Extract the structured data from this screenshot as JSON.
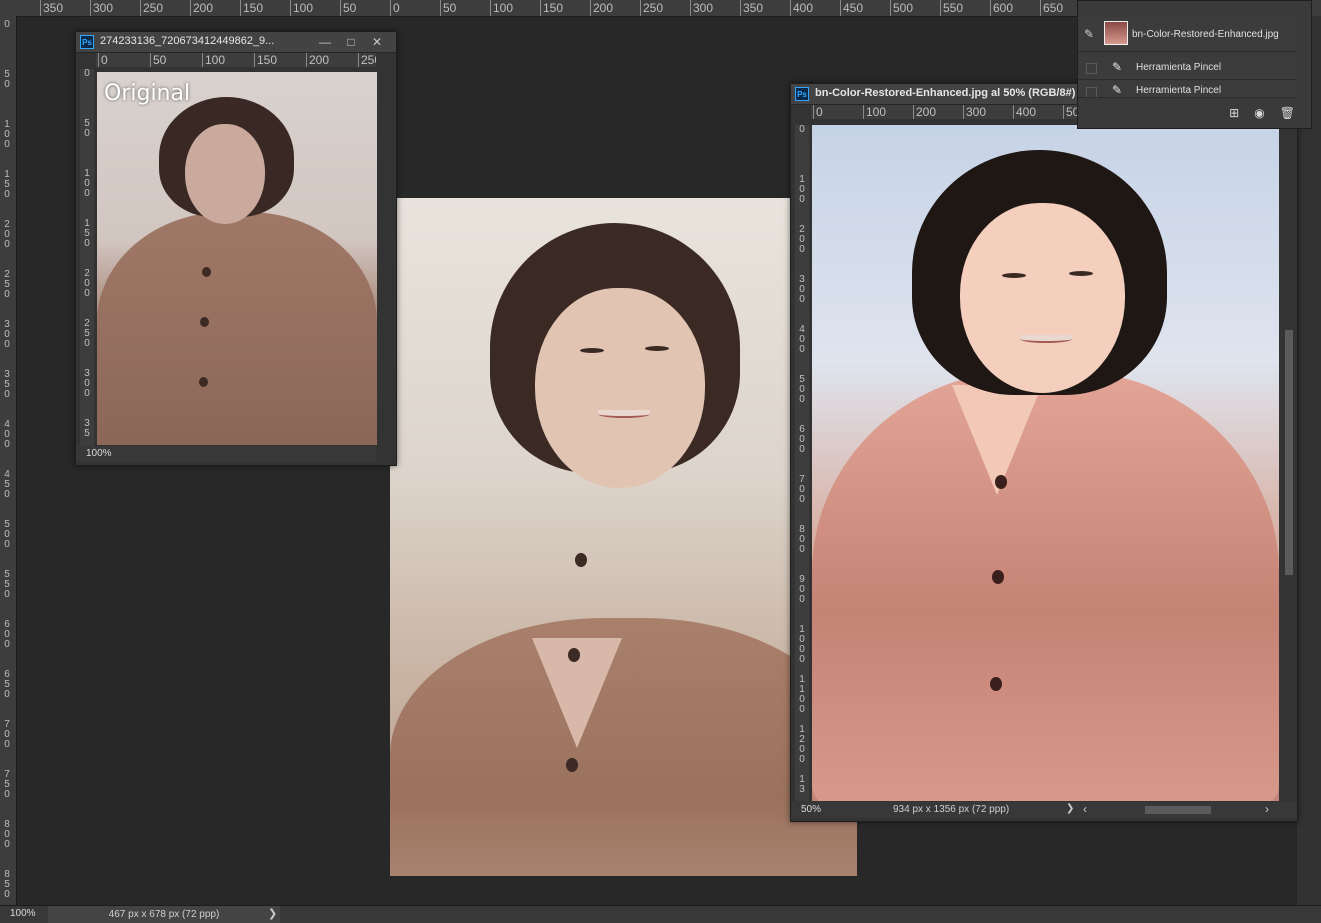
{
  "workspace": {
    "top_ruler_labels": [
      "350",
      "300",
      "250",
      "200",
      "150",
      "100",
      "50",
      "0",
      "50",
      "100",
      "150",
      "200",
      "250",
      "300",
      "350",
      "400",
      "450",
      "500",
      "550",
      "600",
      "650"
    ],
    "left_ruler_labels": [
      "0",
      "50",
      "100",
      "150",
      "200",
      "250",
      "300",
      "350",
      "400",
      "450",
      "500",
      "550",
      "600",
      "650",
      "700",
      "750",
      "800",
      "850"
    ],
    "status_zoom": "100%",
    "status_dims": "467 px x 678 px (72 ppp)",
    "status_arrow": "❯"
  },
  "original_window": {
    "title": "274233136_720673412449862_9...",
    "ps_badge": "Ps",
    "buttons": {
      "minimize": "—",
      "maximize": "□",
      "close": "✕"
    },
    "ruler_top_labels": [
      "0",
      "50",
      "100",
      "150",
      "200",
      "250"
    ],
    "ruler_left_labels": [
      "0",
      "50",
      "100",
      "150",
      "200",
      "250",
      "300",
      "35"
    ],
    "overlay_label": "Original",
    "status_zoom": "100%"
  },
  "enhanced_window": {
    "title": "bn-Color-Restored-Enhanced.jpg al 50% (RGB/8#)",
    "ps_badge": "Ps",
    "ruler_top_labels": [
      "0",
      "100",
      "200",
      "300",
      "400",
      "50"
    ],
    "ruler_left_labels": [
      "0",
      "100",
      "200",
      "300",
      "400",
      "500",
      "600",
      "700",
      "800",
      "900",
      "1000",
      "1100",
      "1200",
      "13"
    ],
    "status_zoom": "50%",
    "status_dims": "934 px x 1356 px (72 ppp)",
    "status_arrow": "❯",
    "scroll_left": "‹",
    "scroll_right": "›"
  },
  "layers_panel": {
    "snapshot_name": "bn-Color-Restored-Enhanced.jpg",
    "history_items": [
      "Herramienta Pincel",
      "Herramienta Pincel"
    ],
    "tool_icons": [
      "new-document-icon",
      "camera-icon",
      "trash-icon"
    ]
  },
  "colors": {
    "workspace_bg": "#282828",
    "panel_bg": "#3a3a3a",
    "ps_blue": "#31a8ff"
  }
}
